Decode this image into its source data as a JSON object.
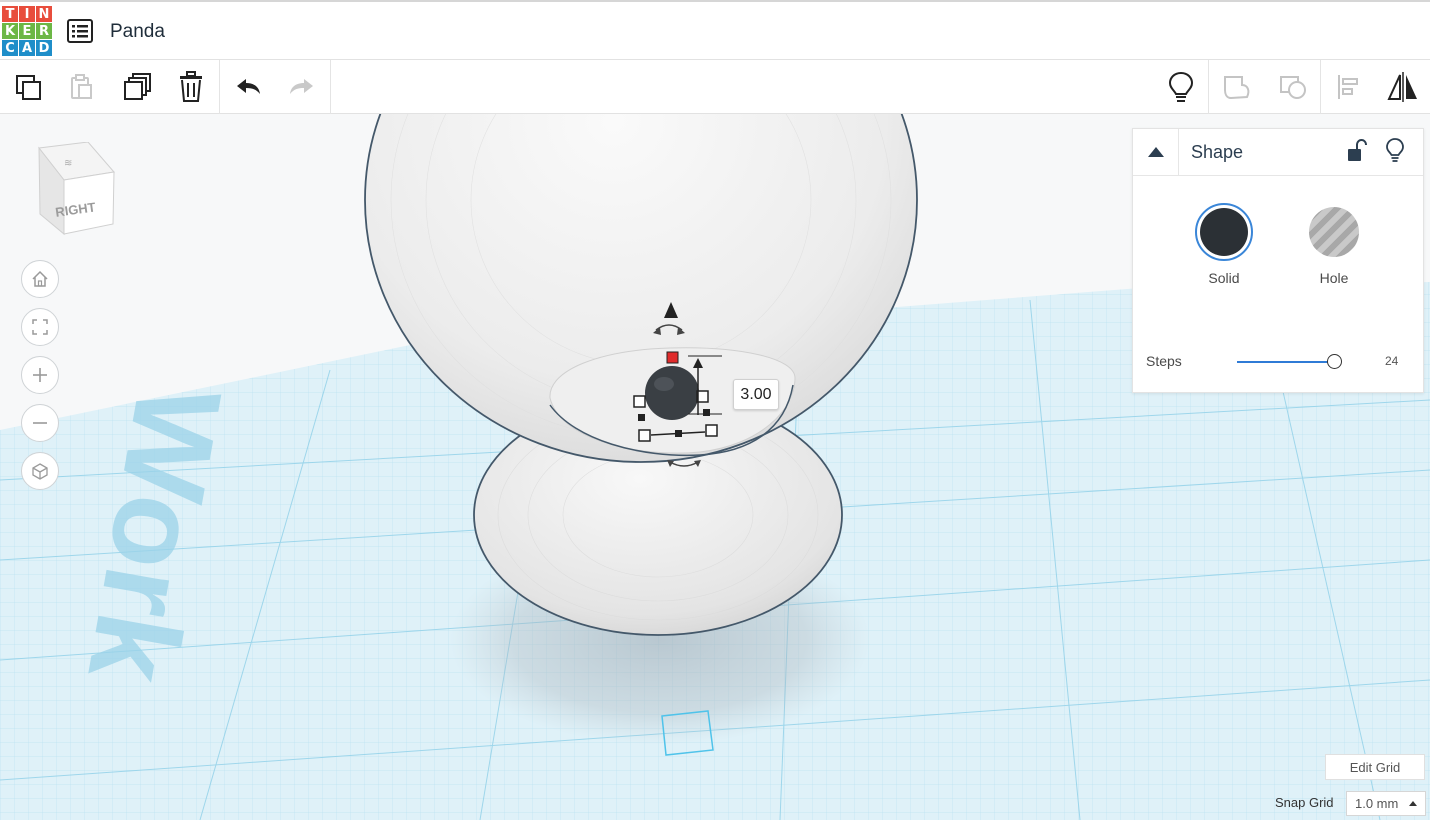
{
  "app": {
    "logo_letters": [
      "T",
      "I",
      "N",
      "K",
      "E",
      "R",
      "C",
      "A",
      "D"
    ],
    "logo_colors": [
      "#e84d3c",
      "#e84d3c",
      "#e84d3c",
      "#6cb745",
      "#6cb745",
      "#6cb745",
      "#1f8ec9",
      "#1f8ec9",
      "#1f8ec9"
    ],
    "title": "Panda"
  },
  "toolbar": {
    "buttons": [
      "copy-icon",
      "paste-icon",
      "duplicate-icon",
      "delete-icon",
      "undo-icon",
      "redo-icon"
    ],
    "right_buttons": [
      "lightbulb-icon",
      "group-icon",
      "ungroup-icon",
      "align-icon",
      "mirror-icon"
    ]
  },
  "viewcube": {
    "face_label": "RIGHT"
  },
  "nav": [
    "home-icon",
    "fit-view-icon",
    "zoom-in-icon",
    "zoom-out-icon",
    "perspective-icon"
  ],
  "workplane": {
    "watermark": "Work"
  },
  "shape_panel": {
    "title": "Shape",
    "solid_label": "Solid",
    "hole_label": "Hole",
    "steps_label": "Steps",
    "steps_value": "24",
    "solid_color": "#2b3035",
    "accent": "#2f7bd6"
  },
  "dimension": {
    "value": "3.00"
  },
  "grid": {
    "edit_label": "Edit Grid",
    "snap_label": "Snap Grid",
    "snap_value": "1.0 mm"
  }
}
